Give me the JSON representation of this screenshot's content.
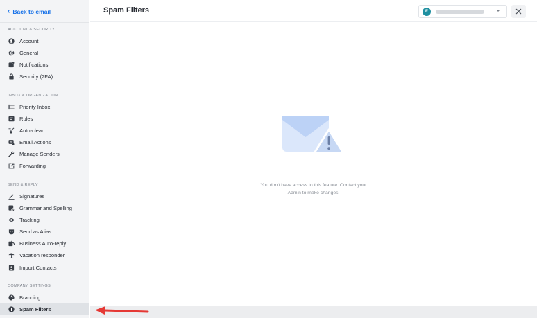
{
  "sidebar": {
    "back_label": "Back to email",
    "sections": [
      {
        "title": "ACCOUNT & SECURITY",
        "items": [
          {
            "label": "Account",
            "icon": "user-circle-icon"
          },
          {
            "label": "General",
            "icon": "gear-icon"
          },
          {
            "label": "Notifications",
            "icon": "notification-icon"
          },
          {
            "label": "Security (2FA)",
            "icon": "lock-icon"
          }
        ]
      },
      {
        "title": "INBOX & ORGANIZATION",
        "items": [
          {
            "label": "Priority Inbox",
            "icon": "priority-list-icon"
          },
          {
            "label": "Rules",
            "icon": "rules-icon"
          },
          {
            "label": "Auto-clean",
            "icon": "broom-icon"
          },
          {
            "label": "Email Actions",
            "icon": "email-actions-icon"
          },
          {
            "label": "Manage Senders",
            "icon": "wrench-icon"
          },
          {
            "label": "Forwarding",
            "icon": "forward-icon"
          }
        ]
      },
      {
        "title": "SEND & REPLY",
        "items": [
          {
            "label": "Signatures",
            "icon": "pen-icon"
          },
          {
            "label": "Grammar and Spelling",
            "icon": "grammar-icon"
          },
          {
            "label": "Tracking",
            "icon": "eye-icon"
          },
          {
            "label": "Send as Alias",
            "icon": "mask-icon"
          },
          {
            "label": "Business Auto-reply",
            "icon": "auto-reply-icon"
          },
          {
            "label": "Vacation responder",
            "icon": "umbrella-icon"
          },
          {
            "label": "Import Contacts",
            "icon": "contacts-icon"
          }
        ]
      },
      {
        "title": "COMPANY SETTINGS",
        "items": [
          {
            "label": "Branding",
            "icon": "palette-icon"
          },
          {
            "label": "Spam Filters",
            "icon": "alert-circle-icon",
            "active": true
          }
        ]
      }
    ]
  },
  "header": {
    "title": "Spam Filters",
    "account_initial": "E",
    "close_icon": "close-icon"
  },
  "main": {
    "empty_state_icon": "envelope-warning-icon",
    "message_line1": "You don't have access to this feature. Contact your",
    "message_line2": "Admin to make changes."
  },
  "colors": {
    "accent": "#1a73e8",
    "sidebar_bg": "#f3f4f6",
    "active_bg": "#dfe2e6",
    "avatar": "#1f8fa0",
    "illustration": "#dbe7fb",
    "arrow": "#e53935"
  }
}
